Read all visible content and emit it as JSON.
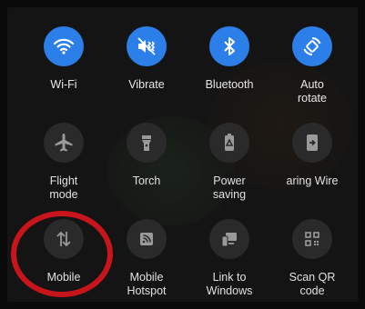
{
  "tiles": [
    {
      "label": "Wi-Fi",
      "state": "on",
      "icon": "wifi-icon"
    },
    {
      "label": "Vibrate",
      "state": "on",
      "icon": "vibrate-icon"
    },
    {
      "label": "Bluetooth",
      "state": "on",
      "icon": "bluetooth-icon"
    },
    {
      "label": "Auto\nrotate",
      "state": "on",
      "icon": "auto-rotate-icon"
    },
    {
      "label": "Flight\nmode",
      "state": "off",
      "icon": "airplane-icon"
    },
    {
      "label": "Torch",
      "state": "off",
      "icon": "torch-icon"
    },
    {
      "label": "Power\nsaving",
      "state": "off",
      "icon": "power-saving-icon"
    },
    {
      "label": "aring    Wire",
      "state": "off",
      "icon": "wireless-sharing-icon"
    },
    {
      "label": "Mobile",
      "state": "off",
      "icon": "mobile-data-icon"
    },
    {
      "label": "Mobile\nHotspot",
      "state": "off",
      "icon": "hotspot-icon"
    },
    {
      "label": "Link to\nWindows",
      "state": "off",
      "icon": "link-to-windows-icon"
    },
    {
      "label": "Scan QR\ncode",
      "state": "off",
      "icon": "qr-code-icon"
    }
  ],
  "colors": {
    "accent": "#2c7fe8",
    "tile_off": "#2a2a2a",
    "highlight_ring": "#c8151b"
  }
}
